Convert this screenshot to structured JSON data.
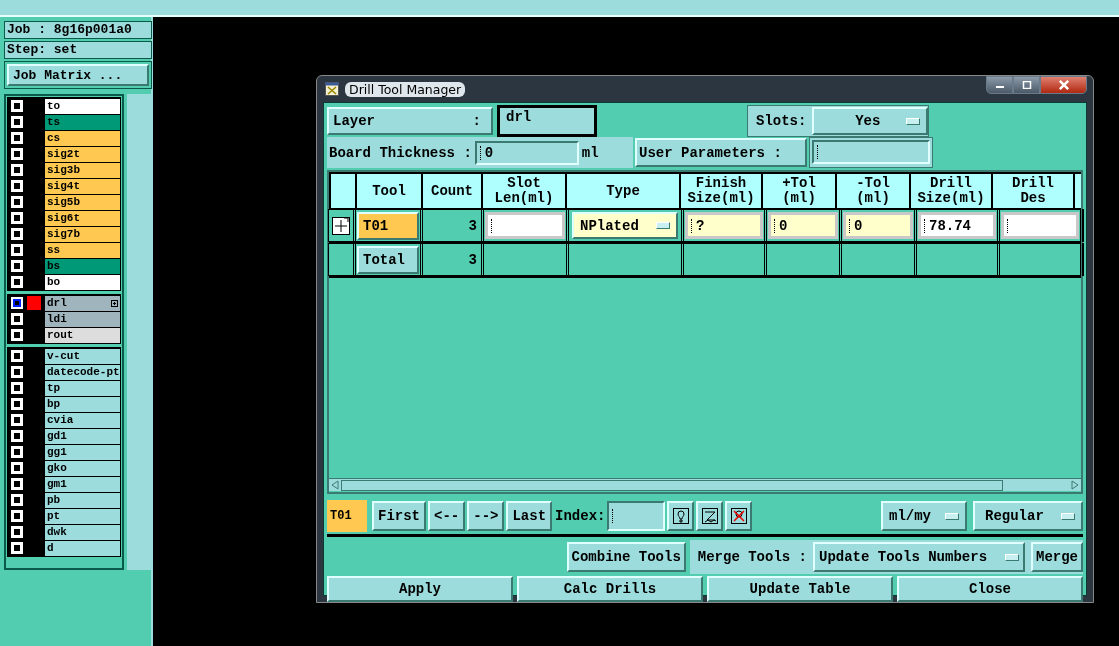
{
  "side_panel": {
    "job": "Job : 8g16p001a0",
    "step": "Step: set",
    "matrix_button": "Job Matrix ...",
    "layer_groups": [
      {
        "layers": [
          {
            "name": "to",
            "color": "#ffffff",
            "active": false
          },
          {
            "name": "ts",
            "color": "#009977",
            "active": false
          },
          {
            "name": "cs",
            "color": "#ffc850",
            "active": false
          },
          {
            "name": "sig2t",
            "color": "#ffc850",
            "active": false
          },
          {
            "name": "sig3b",
            "color": "#ffc850",
            "active": false
          },
          {
            "name": "sig4t",
            "color": "#ffc850",
            "active": false
          },
          {
            "name": "sig5b",
            "color": "#ffc850",
            "active": false
          },
          {
            "name": "sig6t",
            "color": "#ffc850",
            "active": false
          },
          {
            "name": "sig7b",
            "color": "#ffc850",
            "active": false
          },
          {
            "name": "ss",
            "color": "#ffc850",
            "active": false
          },
          {
            "name": "bs",
            "color": "#009977",
            "active": false
          },
          {
            "name": "bo",
            "color": "#ffffff",
            "active": false
          }
        ]
      },
      {
        "layers": [
          {
            "name": "drl",
            "color": "#9fb4bc",
            "active": true
          },
          {
            "name": "ldi",
            "color": "#9fb4bc",
            "active": false
          },
          {
            "name": "rout",
            "color": "#dddddd",
            "active": false
          }
        ]
      },
      {
        "layers": [
          {
            "name": "v-cut",
            "color": "#9ddcdc",
            "active": false
          },
          {
            "name": "datecode-pt",
            "color": "#9ddcdc",
            "active": false
          },
          {
            "name": "tp",
            "color": "#9ddcdc",
            "active": false
          },
          {
            "name": "bp",
            "color": "#9ddcdc",
            "active": false
          },
          {
            "name": "cvia",
            "color": "#9ddcdc",
            "active": false
          },
          {
            "name": "gd1",
            "color": "#9ddcdc",
            "active": false
          },
          {
            "name": "gg1",
            "color": "#9ddcdc",
            "active": false
          },
          {
            "name": "gko",
            "color": "#9ddcdc",
            "active": false
          },
          {
            "name": "gm1",
            "color": "#9ddcdc",
            "active": false
          },
          {
            "name": "pb",
            "color": "#9ddcdc",
            "active": false
          },
          {
            "name": "pt",
            "color": "#9ddcdc",
            "active": false
          },
          {
            "name": "dwk",
            "color": "#9ddcdc",
            "active": false
          },
          {
            "name": "d",
            "color": "#9ddcdc",
            "active": false
          }
        ]
      }
    ]
  },
  "dialog": {
    "title": "Drill Tool Manager",
    "layer": {
      "label": "Layer",
      "separator": ":",
      "value": "drl"
    },
    "slots": {
      "label": "Slots:",
      "value": "Yes"
    },
    "board_thickness": {
      "label": "Board Thickness :",
      "value": "0",
      "unit": "ml"
    },
    "user_parameters": {
      "label": "User Parameters :"
    },
    "table": {
      "columns": [
        "Tool",
        "Count",
        "Slot\nLen(ml)",
        "Type",
        "Finish\nSize(ml)",
        "+Tol\n(ml)",
        "-Tol\n(ml)",
        "Drill\nSize(ml)",
        "Drill\nDes"
      ],
      "rows": [
        {
          "kind": "tool",
          "tool": "T01",
          "selected": true,
          "count": "3",
          "cells": [
            {
              "kind": "input",
              "color": "#ffffff"
            },
            {
              "kind": "dropdown",
              "value": "NPlated",
              "color": "#ffffcc"
            },
            {
              "kind": "input",
              "value": "?",
              "color": "#ffffcc"
            },
            {
              "kind": "input",
              "value": "0",
              "color": "#ffffcc"
            },
            {
              "kind": "input",
              "value": "0",
              "color": "#ffffcc"
            },
            {
              "kind": "input",
              "value": "78.74",
              "color": "#ffffff"
            },
            {
              "kind": "input",
              "color": "#ffffff"
            }
          ]
        },
        {
          "kind": "total",
          "tool": "Total",
          "selected": false,
          "count": "3"
        }
      ]
    },
    "navigation": {
      "current_tool": "T01",
      "buttons": [
        "First",
        "<--",
        "-->",
        "Last"
      ],
      "index_label": "Index:",
      "units": "ml/my",
      "mode": "Regular"
    },
    "merge": {
      "combine_button": "Combine Tools",
      "label": "Merge Tools :",
      "option": "Update Tools Numbers",
      "button": "Merge"
    },
    "actions": [
      "Apply",
      "Calc Drills",
      "Update Table",
      "Close"
    ]
  }
}
